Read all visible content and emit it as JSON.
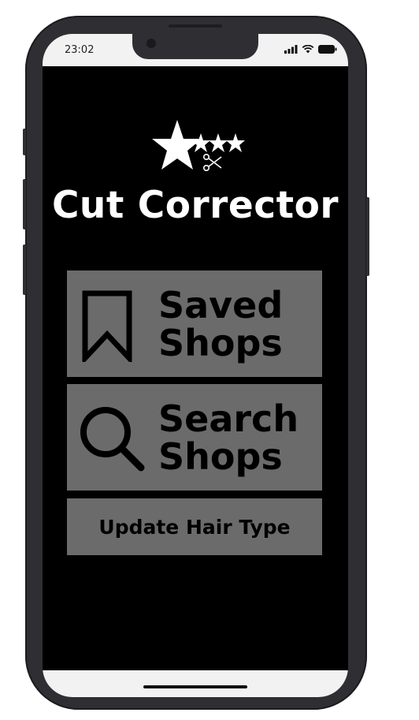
{
  "status_bar": {
    "time": "23:02",
    "icons": [
      "signal-icon",
      "wifi-icon",
      "battery-icon"
    ]
  },
  "app": {
    "title": "Cut Corrector",
    "logo_icons": [
      "star-icon",
      "scissors-icon"
    ]
  },
  "menu": {
    "saved_shops": {
      "line1": "Saved",
      "line2": "Shops",
      "icon": "bookmark-icon"
    },
    "search_shops": {
      "line1": "Search",
      "line2": "Shops",
      "icon": "magnifier-icon"
    },
    "update_hair_type": {
      "label": "Update Hair Type"
    }
  },
  "colors": {
    "screen_bg": "#000000",
    "button_bg": "#6b6b6b",
    "frame": "#2f2f33",
    "title_text": "#ffffff"
  }
}
